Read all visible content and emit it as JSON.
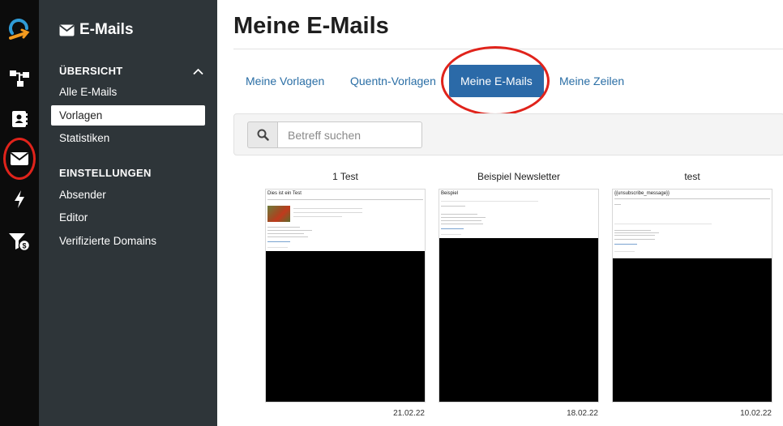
{
  "rail": {
    "items": [
      {
        "name": "logo",
        "icon": "brand-logo-icon"
      },
      {
        "name": "flows",
        "icon": "sitemap-icon"
      },
      {
        "name": "contacts",
        "icon": "address-book-icon"
      },
      {
        "name": "emails",
        "icon": "envelope-icon"
      },
      {
        "name": "automation",
        "icon": "bolt-icon"
      },
      {
        "name": "funnel",
        "icon": "funnel-dollar-icon"
      }
    ],
    "highlight_color": "#e0231b"
  },
  "sidebar": {
    "title": "E-Mails",
    "overview_heading": "ÜBERSICHT",
    "overview_items": [
      "Alle E-Mails",
      "Vorlagen",
      "Statistiken"
    ],
    "active_item": "Vorlagen",
    "settings_heading": "EINSTELLUNGEN",
    "settings_items": [
      "Absender",
      "Editor",
      "Verifizierte Domains"
    ]
  },
  "main": {
    "title": "Meine E-Mails",
    "tabs": [
      "Meine Vorlagen",
      "Quentn-Vorlagen",
      "Meine E-Mails",
      "Meine Zeilen"
    ],
    "active_tab": "Meine E-Mails",
    "search": {
      "placeholder": "Betreff suchen",
      "value": ""
    },
    "cards": [
      {
        "name": "1 Test",
        "date": "21.02.22",
        "preview_heading": "Dies ist ein Test"
      },
      {
        "name": "Beispiel Newsletter",
        "date": "18.02.22",
        "preview_heading": "Beispiel"
      },
      {
        "name": "test",
        "date": "10.02.22",
        "preview_heading": "{{unsubscribe_message}}"
      }
    ]
  },
  "colors": {
    "rail_bg": "#0c0c0c",
    "sidebar_bg": "#2e3539",
    "tab_active_bg": "#2b6aa8",
    "tab_text": "#2a6ea5",
    "annotation": "#e0231b"
  }
}
